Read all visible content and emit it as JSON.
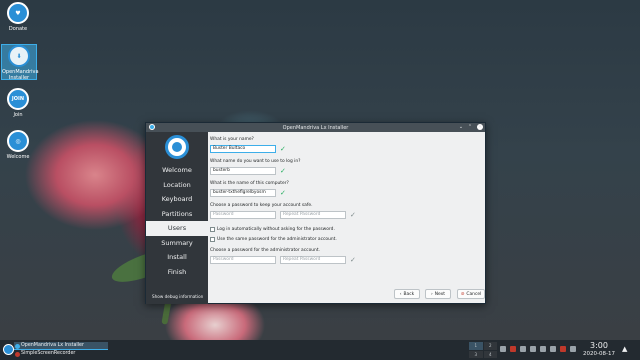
{
  "desktop": {
    "icons": [
      {
        "label": "Donate",
        "glyph": "♥"
      },
      {
        "label": "OpenMandriva Installer",
        "glyph": "⬇"
      },
      {
        "label": "Join",
        "glyph": "JOIN"
      },
      {
        "label": "Welcome",
        "glyph": "◎"
      }
    ]
  },
  "window": {
    "title": "OpenMandriva Lx Installer",
    "controls": {
      "minimize": "⌄",
      "maximize": "⌃",
      "close": "✕"
    }
  },
  "sidebar": {
    "steps": [
      "Welcome",
      "Location",
      "Keyboard",
      "Partitions",
      "Users",
      "Summary",
      "Install",
      "Finish"
    ],
    "active_step": "Users",
    "debug_label": "Show debug information"
  },
  "users_form": {
    "name_question": "What is your name?",
    "name_value": "Buster Bultaco",
    "login_question": "What name do you want to use to log in?",
    "login_value": "busterb",
    "computer_question": "What is the name of this computer?",
    "computer_value": "buster-txtheflgrelbyosm",
    "password_question": "Choose a password to keep your account safe.",
    "password_placeholder": "Password",
    "repeat_placeholder": "Repeat Password",
    "autologin_label": "Log in automatically without asking for the password.",
    "same_password_label": "Use the same password for the administrator account.",
    "admin_question": "Choose a password for the administrator account.",
    "admin_password_placeholder": "Password",
    "admin_repeat_placeholder": "Repeat Password"
  },
  "buttons": {
    "back": "Back",
    "next": "Next",
    "cancel": "Cancel"
  },
  "taskbar": {
    "tasks": [
      "OpenMandriva Lx Installer",
      "SimpleScreenRecorder"
    ],
    "pager": [
      "1",
      "2",
      "3",
      "4"
    ],
    "clock_time": "3:00",
    "clock_date": "2020-08-17"
  },
  "colors": {
    "accent": "#3daee9",
    "sidebar": "#31363b",
    "check_ok": "#27ae60"
  }
}
